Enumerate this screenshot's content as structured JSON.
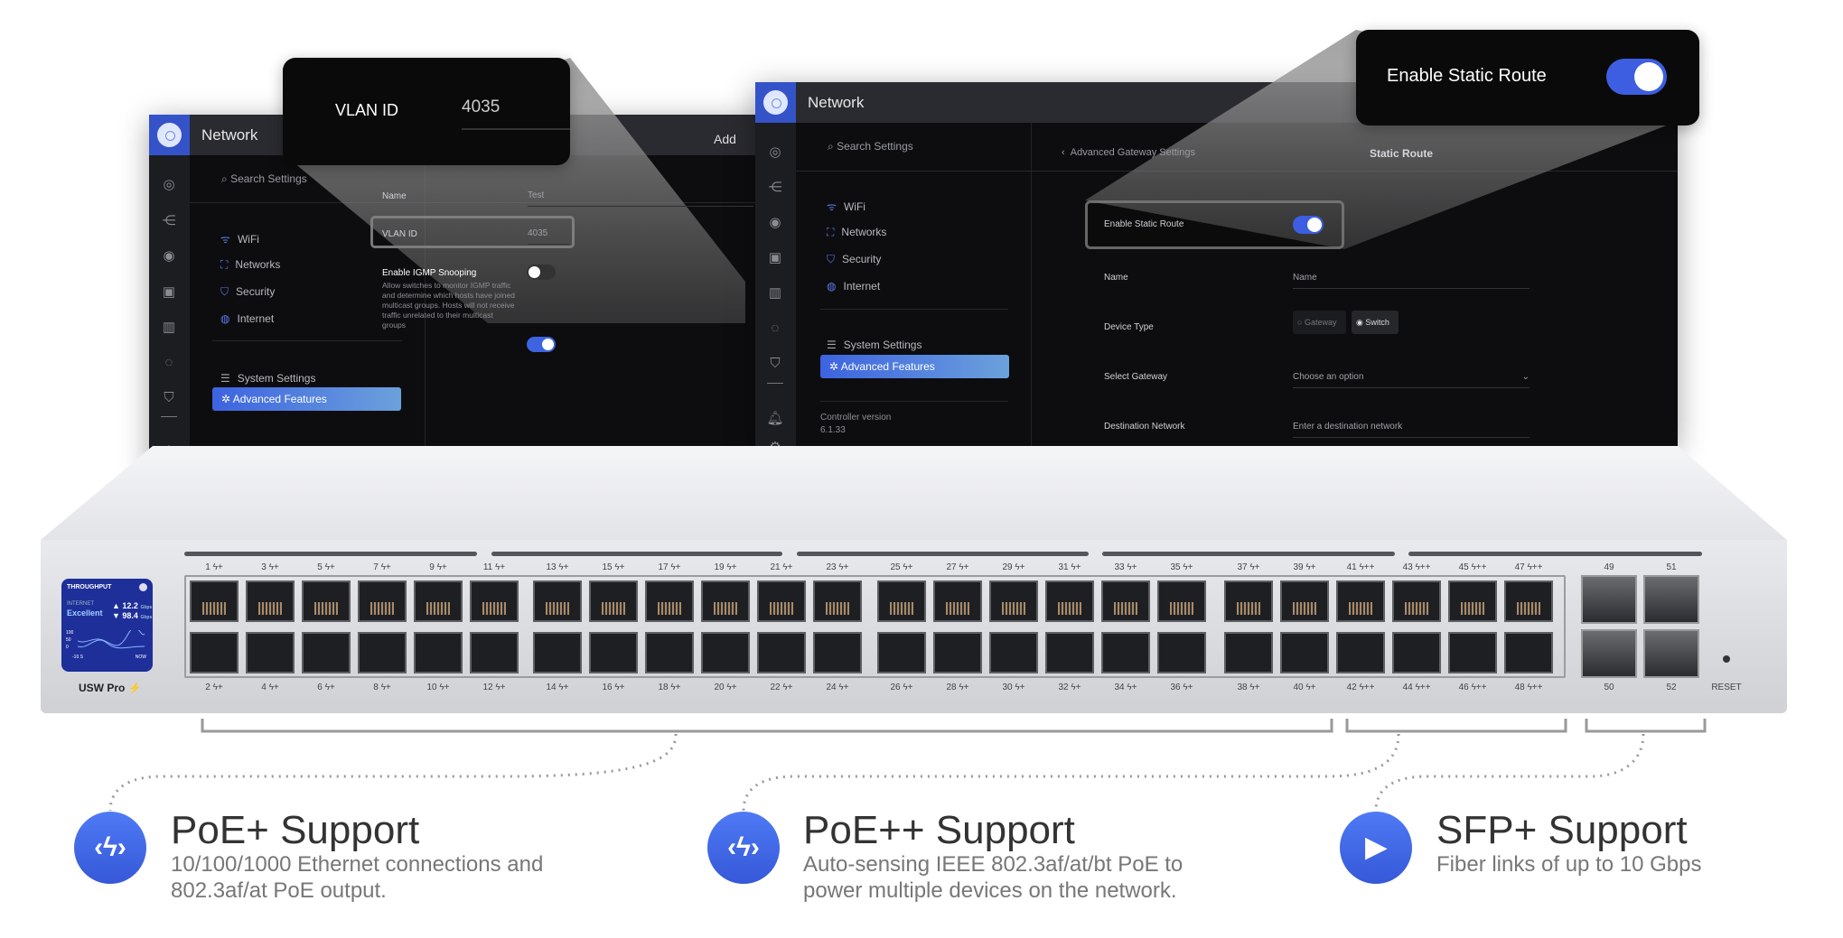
{
  "left_window": {
    "title": "Network",
    "search_placeholder": "Search Settings",
    "menu": [
      {
        "label": "WiFi",
        "icon": "wifi-icon"
      },
      {
        "label": "Networks",
        "icon": "networks-icon"
      },
      {
        "label": "Security",
        "icon": "shield-icon"
      },
      {
        "label": "Internet",
        "icon": "globe-icon"
      }
    ],
    "system_settings": "System Settings",
    "advanced_features": "Advanced Features",
    "header_right": "Add",
    "name_label": "Name",
    "name_value": "Test",
    "vlan_label": "VLAN ID",
    "vlan_value": "4035",
    "igmp_title": "Enable IGMP Snooping",
    "igmp_desc": "Allow switches to monitor IGMP traffic and determine which hosts have joined multicast groups. Hosts will not receive traffic unrelated to their multicast groups",
    "igmp_enabled": false
  },
  "vlan_callout": {
    "label": "VLAN ID",
    "value": "4035"
  },
  "right_window": {
    "title": "Network",
    "search_placeholder": "Search Settings",
    "menu": [
      {
        "label": "WiFi"
      },
      {
        "label": "Networks"
      },
      {
        "label": "Security"
      },
      {
        "label": "Internet"
      }
    ],
    "system_settings": "System Settings",
    "advanced_features": "Advanced Features",
    "controller_version_label": "Controller version",
    "controller_version": "6.1.33",
    "breadcrumb": "Advanced Gateway Settings",
    "page_title": "Static Route",
    "enable_label": "Enable Static Route",
    "enable_on": true,
    "name_label": "Name",
    "name_placeholder": "Name",
    "device_type_label": "Device Type",
    "device_type_options": [
      "Gateway",
      "Switch"
    ],
    "device_type_selected": "Switch",
    "gateway_label": "Select Gateway",
    "gateway_placeholder": "Choose an option",
    "dest_label": "Destination Network",
    "dest_placeholder": "Enter a destination network"
  },
  "static_callout": {
    "label": "Enable Static Route",
    "enabled": true
  },
  "switch": {
    "model": "USW Pro",
    "screen": {
      "title": "THROUGHPUT",
      "internet": "INTERNET",
      "quality": "Excellent",
      "up": "12.2",
      "down": "98.4",
      "unit": "Gbps",
      "y_ticks": [
        "100",
        "50",
        "0"
      ],
      "x_start": "-10 S",
      "x_end": "NOW"
    },
    "top_ports": [
      "1",
      "3",
      "5",
      "7",
      "9",
      "11",
      "13",
      "15",
      "17",
      "19",
      "21",
      "23",
      "25",
      "27",
      "29",
      "31",
      "33",
      "35",
      "37",
      "39",
      "41",
      "43",
      "45",
      "47"
    ],
    "bottom_ports": [
      "2",
      "4",
      "6",
      "8",
      "10",
      "12",
      "14",
      "16",
      "18",
      "20",
      "22",
      "24",
      "26",
      "28",
      "30",
      "32",
      "34",
      "36",
      "38",
      "40",
      "42",
      "44",
      "46",
      "48"
    ],
    "poe_plus": "+",
    "poe_plus_plus": "++",
    "sfp_top": [
      "49",
      "51"
    ],
    "sfp_bottom": [
      "50",
      "52"
    ],
    "reset": "RESET"
  },
  "features": [
    {
      "title": "PoE+ Support",
      "desc": "10/100/1000 Ethernet connections and 802.3af/at PoE output.",
      "icon": "poe-icon"
    },
    {
      "title": "PoE++ Support",
      "desc": "Auto-sensing IEEE 802.3af/at/bt PoE to power multiple devices on the network.",
      "icon": "poe-icon"
    },
    {
      "title": "SFP+ Support",
      "desc": "Fiber links of up to 10 Gbps",
      "icon": "fast-forward-icon"
    }
  ],
  "accent": "#3d63e0"
}
